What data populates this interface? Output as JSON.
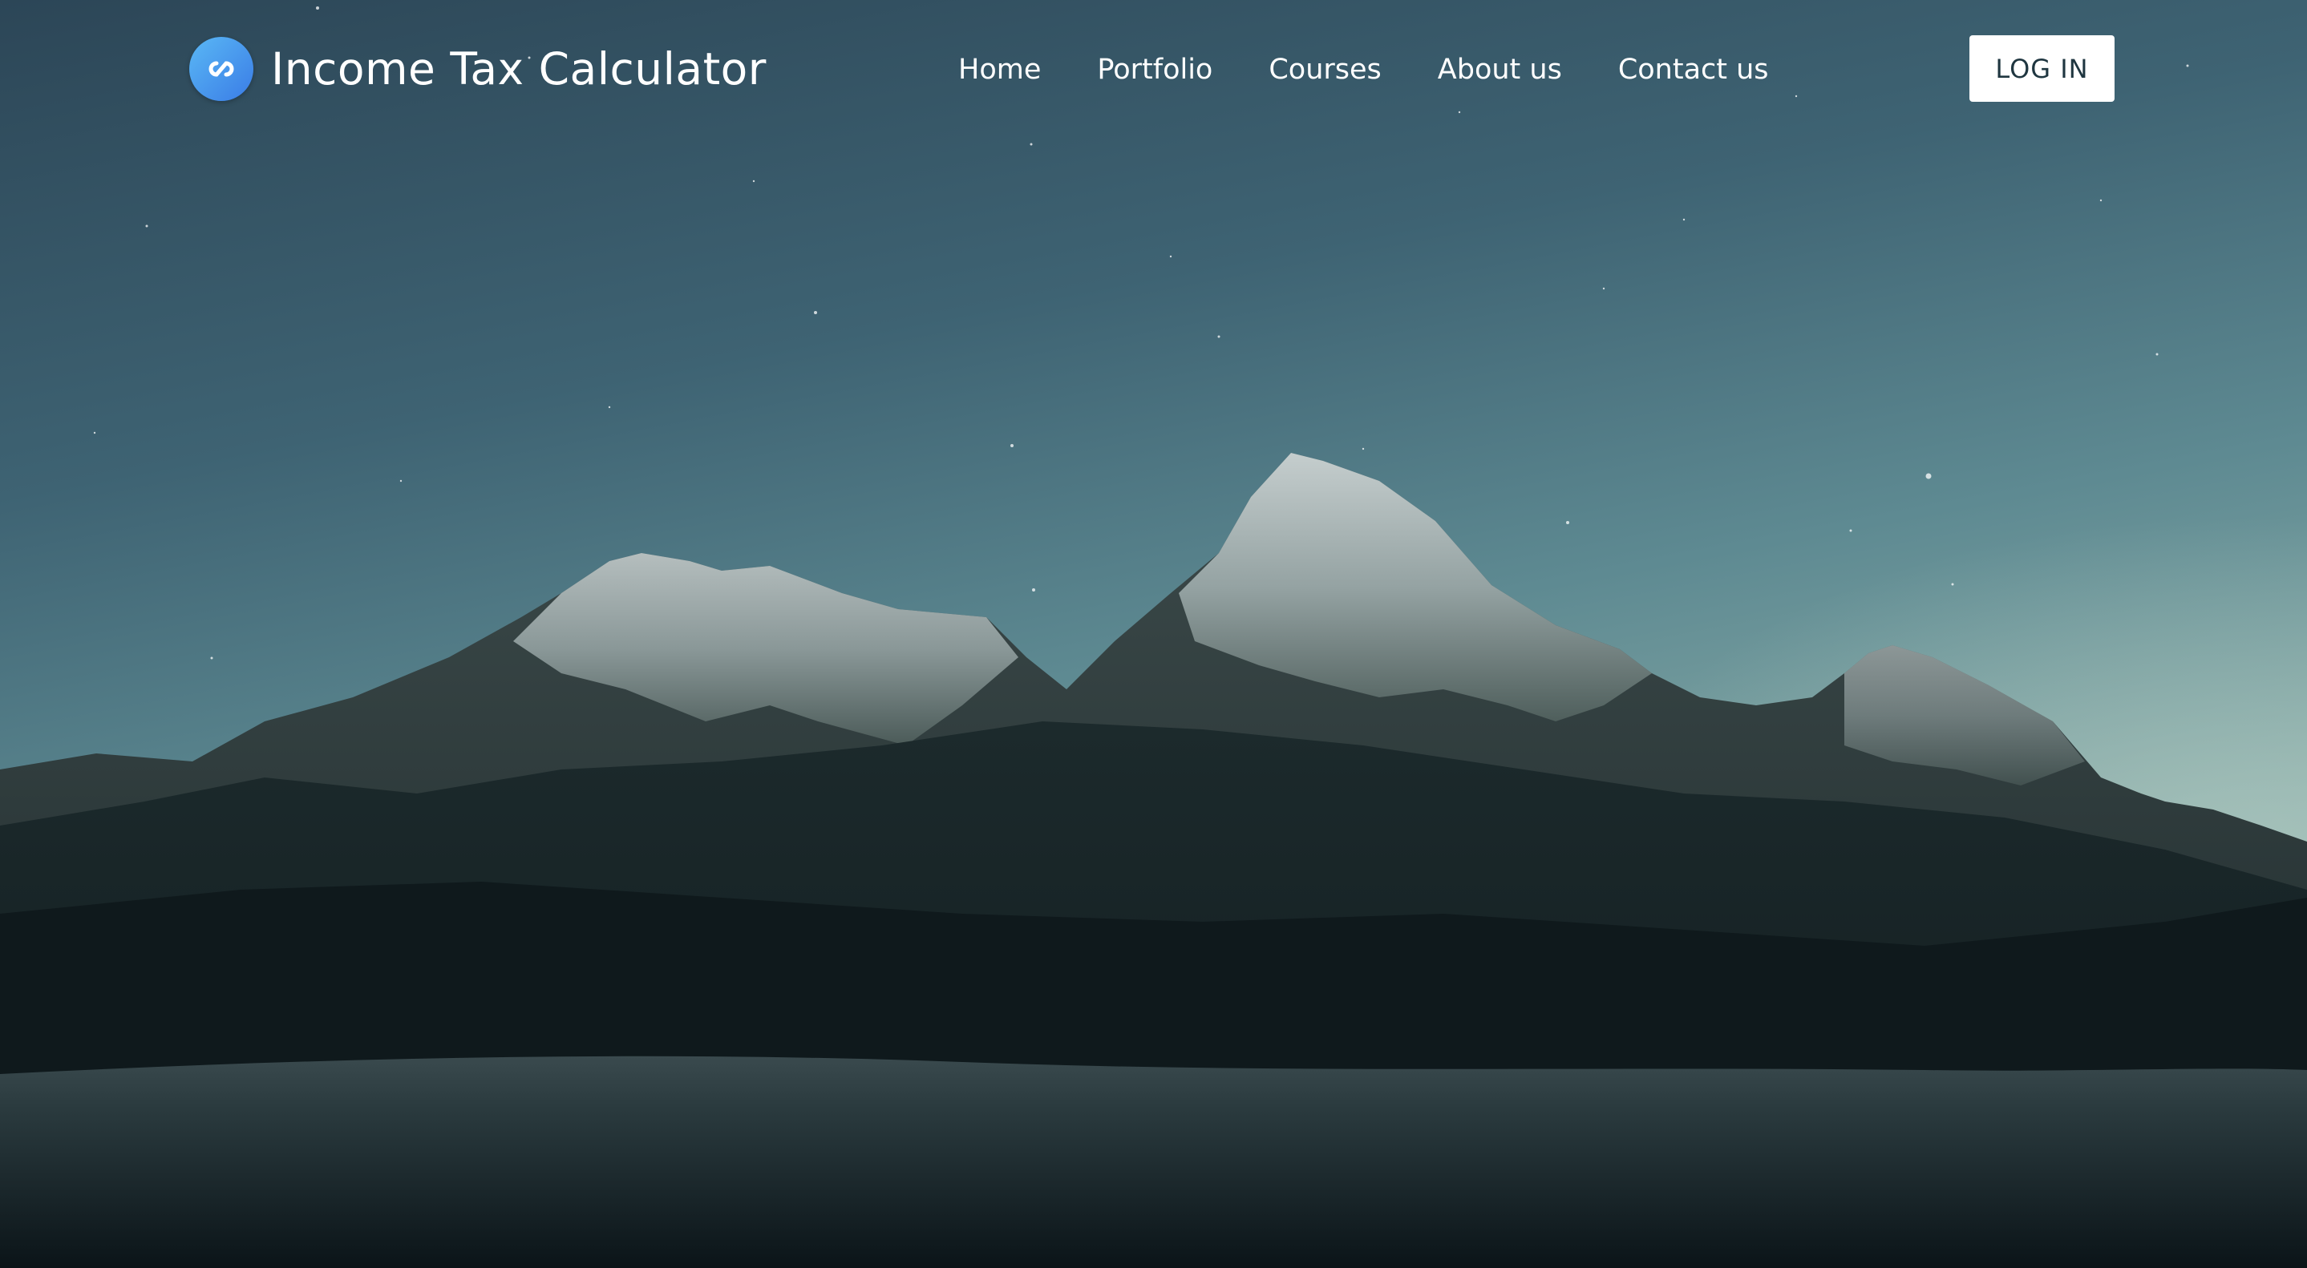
{
  "header": {
    "brand_title": "Income Tax Calculator",
    "logo_icon": "infinity-logo-icon",
    "nav": [
      {
        "label": "Home"
      },
      {
        "label": "Portfolio"
      },
      {
        "label": "Courses"
      },
      {
        "label": "About us"
      },
      {
        "label": "Contact us"
      }
    ],
    "login_label": "LOG IN"
  },
  "theme": {
    "logo_gradient": [
      "#5ab8f5",
      "#3a7ce6"
    ],
    "nav_text": "#ffffff",
    "button_bg": "#ffffff",
    "button_text": "#1f3640"
  },
  "hero": {
    "background": "night-sky-snow-mountains-photo"
  }
}
